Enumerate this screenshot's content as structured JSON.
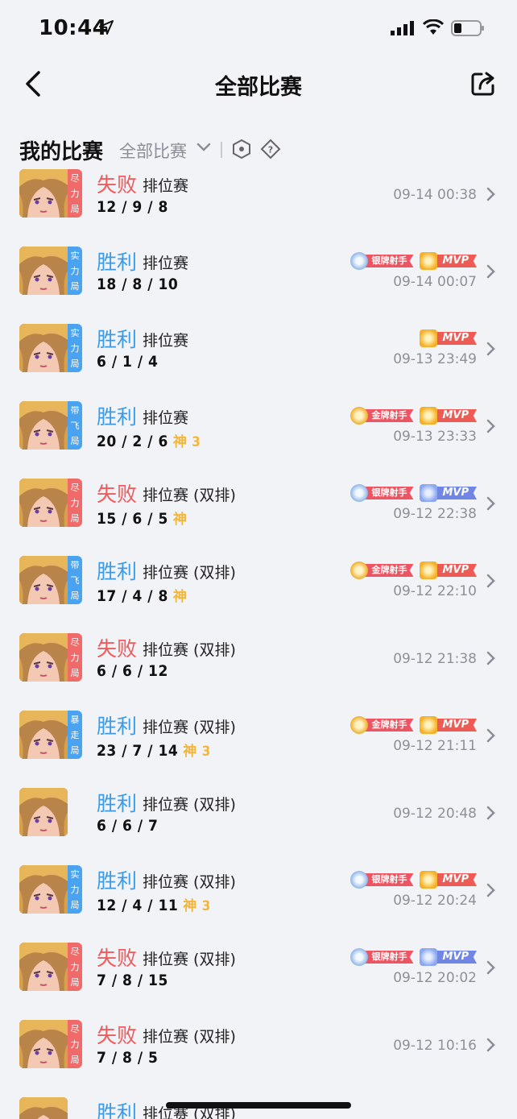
{
  "status": {
    "time": "10:44"
  },
  "nav": {
    "title": "全部比赛"
  },
  "filter": {
    "title": "我的比赛",
    "select": "全部比赛"
  },
  "matches": [
    {
      "result": "失败",
      "outcome": "lose",
      "mode": "排位赛",
      "kda": "12 / 9 / 8",
      "god": "",
      "time": "09-14 00:38",
      "tag": "尽\n力\n局",
      "tag_color": "red",
      "badges": []
    },
    {
      "result": "胜利",
      "outcome": "win",
      "mode": "排位赛",
      "kda": "18 / 8 / 10",
      "god": "",
      "time": "09-14 00:07",
      "tag": "实\n力\n局",
      "tag_color": "blue",
      "badges": [
        "silver",
        "mvp"
      ]
    },
    {
      "result": "胜利",
      "outcome": "win",
      "mode": "排位赛",
      "kda": "6 / 1 / 4",
      "god": "",
      "time": "09-13 23:49",
      "tag": "实\n力\n局",
      "tag_color": "blue",
      "badges": [
        "mvp"
      ]
    },
    {
      "result": "胜利",
      "outcome": "win",
      "mode": "排位赛",
      "kda": "20 / 2 / 6",
      "god": "神 3",
      "time": "09-13 23:33",
      "tag": "带\n飞\n局",
      "tag_color": "blue",
      "badges": [
        "gold",
        "mvp"
      ]
    },
    {
      "result": "失败",
      "outcome": "lose",
      "mode": "排位赛 (双排)",
      "kda": "15 / 6 / 5",
      "god": "神",
      "time": "09-12 22:38",
      "tag": "尽\n力\n局",
      "tag_color": "red",
      "badges": [
        "silver",
        "mvp-blue"
      ]
    },
    {
      "result": "胜利",
      "outcome": "win",
      "mode": "排位赛 (双排)",
      "kda": "17 / 4 / 8",
      "god": "神",
      "time": "09-12 22:10",
      "tag": "带\n飞\n局",
      "tag_color": "blue",
      "badges": [
        "gold",
        "mvp"
      ]
    },
    {
      "result": "失败",
      "outcome": "lose",
      "mode": "排位赛 (双排)",
      "kda": "6 / 6 / 12",
      "god": "",
      "time": "09-12 21:38",
      "tag": "尽\n力\n局",
      "tag_color": "red",
      "badges": []
    },
    {
      "result": "胜利",
      "outcome": "win",
      "mode": "排位赛 (双排)",
      "kda": "23 / 7 / 14",
      "god": "神 3",
      "time": "09-12 21:11",
      "tag": "暴\n走\n局",
      "tag_color": "blue",
      "badges": [
        "gold",
        "mvp"
      ]
    },
    {
      "result": "胜利",
      "outcome": "win",
      "mode": "排位赛 (双排)",
      "kda": "6 / 6 / 7",
      "god": "",
      "time": "09-12 20:48",
      "tag": "",
      "tag_color": "",
      "badges": []
    },
    {
      "result": "胜利",
      "outcome": "win",
      "mode": "排位赛 (双排)",
      "kda": "12 / 4 / 11",
      "god": "神 3",
      "time": "09-12 20:24",
      "tag": "实\n力\n局",
      "tag_color": "blue",
      "badges": [
        "silver",
        "mvp"
      ]
    },
    {
      "result": "失败",
      "outcome": "lose",
      "mode": "排位赛 (双排)",
      "kda": "7 / 8 / 15",
      "god": "",
      "time": "09-12 20:02",
      "tag": "尽\n力\n局",
      "tag_color": "red",
      "badges": [
        "silver",
        "mvp-blue"
      ]
    },
    {
      "result": "失败",
      "outcome": "lose",
      "mode": "排位赛 (双排)",
      "kda": "7 / 8 / 5",
      "god": "",
      "time": "09-12 10:16",
      "tag": "尽\n力\n局",
      "tag_color": "red",
      "badges": []
    },
    {
      "result": "胜利",
      "outcome": "win",
      "mode": "排位赛 (双排)",
      "kda": "",
      "god": "",
      "time": "",
      "tag": "",
      "tag_color": "",
      "badges": []
    }
  ],
  "badge_labels": {
    "silver": "银牌射手",
    "gold": "金牌射手",
    "mvp": "MVP",
    "mvp-blue": "MVP"
  },
  "colors": {
    "win": "#3b9be8",
    "lose": "#f05a5a",
    "god": "#f3b63c",
    "background": "#f2f3f7"
  }
}
